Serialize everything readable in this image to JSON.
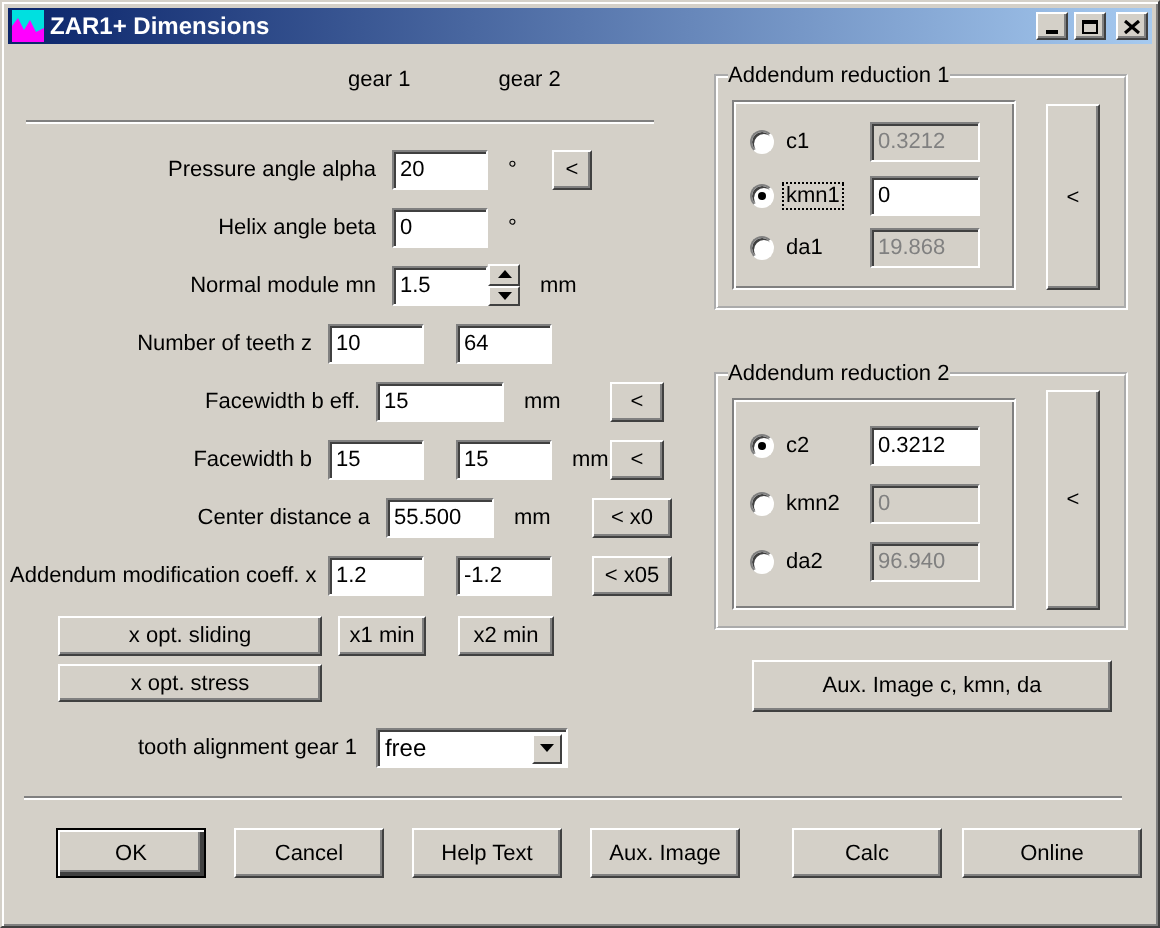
{
  "window": {
    "title": "ZAR1+ Dimensions"
  },
  "column_headers": [
    "gear 1",
    "gear 2"
  ],
  "rows": [
    {
      "kind": "single",
      "label": "Pressure angle alpha",
      "value": "20",
      "unit": "°",
      "button": "<"
    },
    {
      "kind": "single",
      "label": "Helix angle beta",
      "value": "0",
      "unit": "°"
    },
    {
      "kind": "spin",
      "label": "Normal module mn",
      "value": "1.5",
      "unit": "mm"
    },
    {
      "kind": "pair",
      "label": "Number of teeth z",
      "values": [
        "10",
        "64"
      ]
    },
    {
      "kind": "wide",
      "label": "Facewidth b eff.",
      "value": "15",
      "unit": "mm",
      "button": "<"
    },
    {
      "kind": "pair",
      "label": "Facewidth b",
      "values": [
        "15",
        "15"
      ],
      "unit": "mm",
      "button": "<"
    },
    {
      "kind": "center",
      "label": "Center distance a",
      "value": "55.500",
      "unit": "mm",
      "button": "< x0"
    },
    {
      "kind": "pair",
      "label": "Addendum modification coeff. x",
      "values": [
        "1.2",
        "-1.2"
      ],
      "button": "< x05"
    }
  ],
  "x_buttons": [
    "x opt. sliding",
    "x1 min",
    "x2 min",
    "x opt. stress"
  ],
  "tooth_alignment": {
    "label": "tooth alignment gear 1",
    "value": "free"
  },
  "addendum_groups": [
    {
      "title": "Addendum reduction 1",
      "button": "<",
      "options": [
        {
          "label": "c1",
          "value": "0.3212",
          "selected": false,
          "focused": false
        },
        {
          "label": "kmn1",
          "value": "0",
          "selected": true,
          "focused": true
        },
        {
          "label": "da1",
          "value": "19.868",
          "selected": false,
          "focused": false
        }
      ]
    },
    {
      "title": "Addendum reduction 2",
      "button": "<",
      "options": [
        {
          "label": "c2",
          "value": "0.3212",
          "selected": true,
          "focused": false
        },
        {
          "label": "kmn2",
          "value": "0",
          "selected": false,
          "focused": false
        },
        {
          "label": "da2",
          "value": "96.940",
          "selected": false,
          "focused": false
        }
      ]
    }
  ],
  "aux_image_button": "Aux. Image c, kmn, da",
  "buttons": [
    {
      "label": "OK",
      "default": true
    },
    {
      "label": "Cancel",
      "default": false
    },
    {
      "label": "Help Text",
      "default": false
    },
    {
      "label": "Aux. Image",
      "default": false
    },
    {
      "label": "Calc",
      "default": false
    },
    {
      "label": "Online",
      "default": false
    }
  ]
}
